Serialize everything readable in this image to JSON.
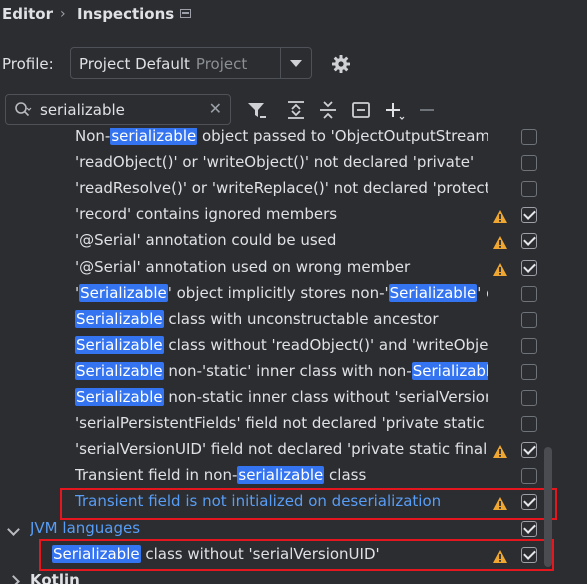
{
  "breadcrumb": {
    "editor": "Editor",
    "separator": "›",
    "inspections": "Inspections"
  },
  "profile": {
    "label": "Profile:",
    "value": "Project Default",
    "scope": "Project"
  },
  "search": {
    "value": "serializable"
  },
  "rows": [
    {
      "parts": [
        "Non-",
        {
          "hl": "serializable"
        },
        " object passed to 'ObjectOutputStream'"
      ],
      "warn": false,
      "checked": false
    },
    {
      "parts": [
        "'readObject()' or 'writeObject()' not declared 'private'"
      ],
      "warn": false,
      "checked": false
    },
    {
      "parts": [
        "'readResolve()' or 'writeReplace()' not declared 'protected'"
      ],
      "warn": false,
      "checked": false
    },
    {
      "parts": [
        "'record' contains ignored members"
      ],
      "warn": true,
      "checked": true
    },
    {
      "parts": [
        "'@Serial' annotation could be used"
      ],
      "warn": true,
      "checked": true
    },
    {
      "parts": [
        "'@Serial' annotation used on wrong member"
      ],
      "warn": true,
      "checked": true
    },
    {
      "parts": [
        "'",
        {
          "hl": "Serializable"
        },
        "' object implicitly stores non-'",
        {
          "hl": "Serializable"
        },
        "' object"
      ],
      "warn": false,
      "checked": false
    },
    {
      "parts": [
        {
          "hl": "Serializable"
        },
        " class with unconstructable ancestor"
      ],
      "warn": false,
      "checked": false
    },
    {
      "parts": [
        {
          "hl": "Serializable"
        },
        " class without 'readObject()' and 'writeObject()'"
      ],
      "warn": false,
      "checked": false
    },
    {
      "parts": [
        {
          "hl": "Serializable"
        },
        " non-'static' inner class with non-",
        {
          "hl": "Serializable"
        },
        " outer class"
      ],
      "warn": false,
      "checked": false
    },
    {
      "parts": [
        {
          "hl": "Serializable"
        },
        " non-static inner class without 'serialVersionUID'"
      ],
      "warn": false,
      "checked": false
    },
    {
      "parts": [
        "'serialPersistentFields' field not declared 'private static final'"
      ],
      "warn": false,
      "checked": false
    },
    {
      "parts": [
        "'serialVersionUID' field not declared 'private static final long'"
      ],
      "warn": true,
      "checked": true
    },
    {
      "parts": [
        "Transient field in non-",
        {
          "hl": "serializable"
        },
        " class"
      ],
      "warn": false,
      "checked": false
    },
    {
      "parts": [
        "Transient field is not initialized on deserialization"
      ],
      "warn": true,
      "checked": true,
      "blue": true
    }
  ],
  "group": {
    "label": "JVM languages",
    "checked": true
  },
  "group_row": {
    "parts": [
      {
        "hl": "Serializable"
      },
      " class without 'serialVersionUID'"
    ],
    "warn": true,
    "checked": true
  },
  "next_group": {
    "label": "Kotlin"
  },
  "colors": {
    "background": "#2b2d30",
    "highlight": "#3574f0",
    "link_blue": "#589df6",
    "warning": "#f0a732",
    "annotation_red": "#e5161e"
  }
}
